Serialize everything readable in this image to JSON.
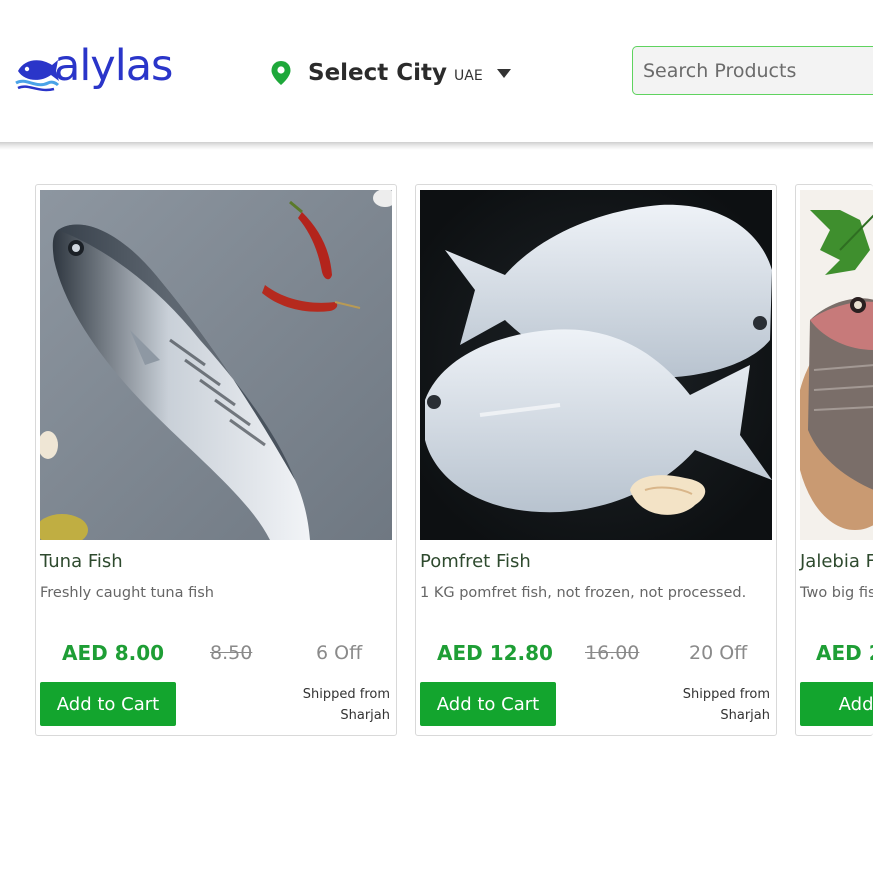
{
  "brand": {
    "name": "alylas"
  },
  "location": {
    "label": "Select City",
    "country": "UAE"
  },
  "search": {
    "placeholder": "Search Products"
  },
  "colors": {
    "brand_blue": "#2a35c9",
    "accent_green": "#13a52e",
    "price_green": "#1e9e35"
  },
  "icons": {
    "location": "map-pin-icon",
    "dropdown": "caret-down-icon"
  },
  "products": [
    {
      "name": "Tuna Fish",
      "description": "Freshly caught tuna fish",
      "price": "AED 8.00",
      "old_price": "8.50",
      "discount": "6 Off",
      "cta": "Add to Cart",
      "shipping_line1": "Shipped from",
      "shipping_line2": "Sharjah"
    },
    {
      "name": "Pomfret Fish",
      "description": "1 KG pomfret fish, not frozen, not processed.",
      "price": "AED 12.80",
      "old_price": "16.00",
      "discount": "20 Off",
      "cta": "Add to Cart",
      "shipping_line1": "Shipped from",
      "shipping_line2": "Sharjah"
    },
    {
      "name": "Jalebia F",
      "description": "Two big fis",
      "price": "AED 2",
      "cta": "Add to"
    }
  ]
}
